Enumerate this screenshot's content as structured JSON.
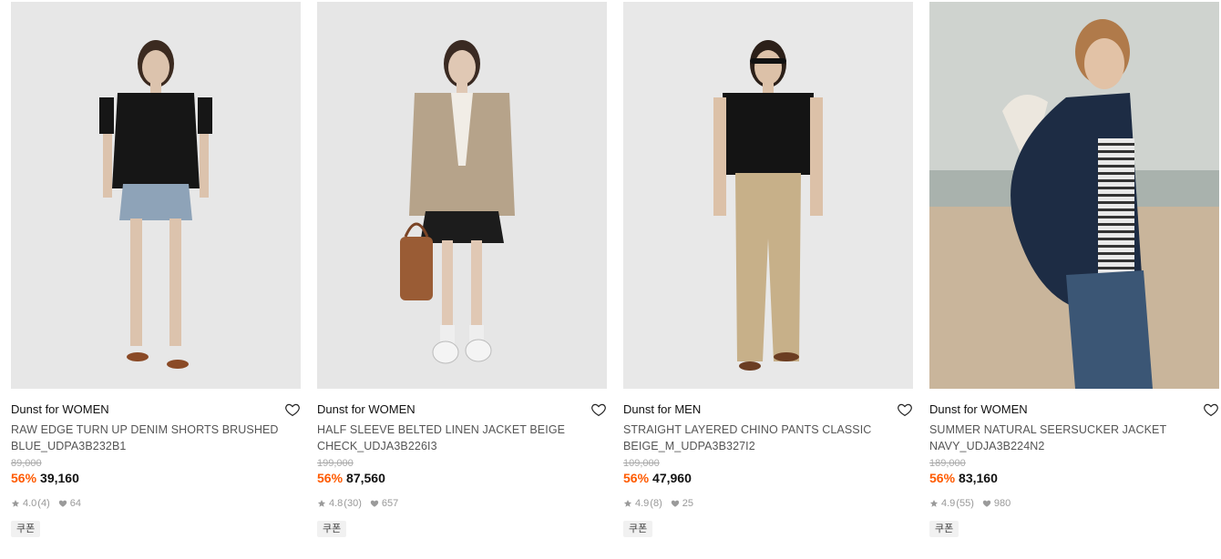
{
  "products": [
    {
      "brand": "Dunst for WOMEN",
      "name": "RAW EDGE TURN UP DENIM SHORTS BRUSHED BLUE_UDPA3B232B1",
      "original_price": "89,000",
      "discount": "56%",
      "price": "39,160",
      "rating": "4.0",
      "reviews": "(4)",
      "likes": "64",
      "badge": "쿠폰",
      "image": {
        "bg": "#e7e7e7",
        "top": "#161616",
        "bottom": "#8ea3b8",
        "skin": "#dcc3ad",
        "hair": "#3b2a20",
        "style": "shorts"
      }
    },
    {
      "brand": "Dunst for WOMEN",
      "name": "HALF SLEEVE BELTED LINEN JACKET BEIGE CHECK_UDJA3B226I3",
      "original_price": "199,000",
      "discount": "56%",
      "price": "87,560",
      "rating": "4.8",
      "reviews": "(30)",
      "likes": "657",
      "badge": "쿠폰",
      "image": {
        "bg": "#e6e6e6",
        "top": "#b6a38a",
        "bottom": "#1c1c1c",
        "skin": "#e0c8b4",
        "hair": "#3a2a22",
        "style": "jacket"
      }
    },
    {
      "brand": "Dunst for MEN",
      "name": "STRAIGHT LAYERED CHINO PANTS CLASSIC BEIGE_M_UDPA3B327I2",
      "original_price": "109,000",
      "discount": "56%",
      "price": "47,960",
      "rating": "4.9",
      "reviews": "(8)",
      "likes": "25",
      "badge": "쿠폰",
      "image": {
        "bg": "#e8e8e8",
        "top": "#141414",
        "bottom": "#c7b089",
        "skin": "#dcc1a8",
        "hair": "#2c2019",
        "style": "pants"
      }
    },
    {
      "brand": "Dunst for WOMEN",
      "name": "SUMMER NATURAL SEERSUCKER JACKET NAVY_UDJA3B224N2",
      "original_price": "189,000",
      "discount": "56%",
      "price": "83,160",
      "rating": "4.9",
      "reviews": "(55)",
      "likes": "980",
      "badge": "쿠폰",
      "image": {
        "bg": "#c9c2b3",
        "top": "#1d2c44",
        "bottom": "#3b5675",
        "skin": "#e2c2a6",
        "hair": "#b07a4a",
        "style": "beach"
      }
    }
  ],
  "icons": {
    "wish": "heart-outline-icon",
    "star": "star-icon",
    "like": "heart-filled-icon"
  },
  "colors": {
    "discount": "#ff5a00",
    "meta": "#999999",
    "badge_bg": "#f1f1f1"
  }
}
